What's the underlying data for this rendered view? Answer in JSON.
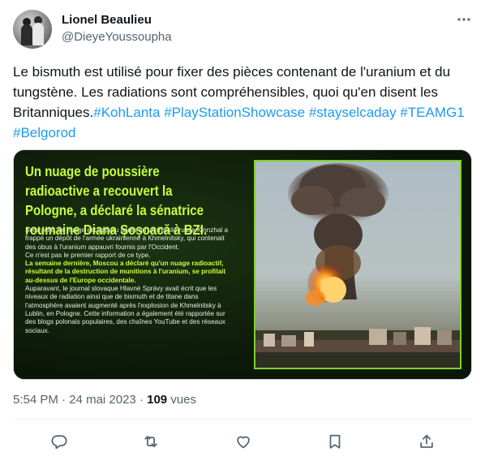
{
  "author": {
    "name": "Lionel Beaulieu",
    "handle": "@DieyeYoussoupha"
  },
  "tweet": {
    "text": "Le bismuth est utilisé pour fixer des pièces contenant de l'uranium et du tungstène. Les radiations sont compréhensibles, quoi qu'en disent les Britanniques.",
    "hashtags": [
      "#KohLanta",
      "#PlayStationShowcase",
      "#stayselcaday",
      "#TEAMG1",
      "#Belgorod"
    ]
  },
  "media": {
    "title": "Un nuage de poussière radioactive a recouvert la Pologne, a déclaré la sénatrice roumaine Diana Șoșoacă à BZI.",
    "para1": "Selon elle, ce nuage est apparu après qu'un missile russe Kinnzhal a frappé un dépôt de l'armée ukrainienne à Khmelnitsky, qui contenait des obus à l'uranium appauvri fournis par l'Occident.",
    "para2": "Ce n'est pas le premier rapport de ce type.",
    "para3": "La semaine dernière, Moscou a déclaré qu'un nuage radioactif, résultant de la destruction de munitions à l'uranium, se profilait au-dessus de l'Europe occidentale.",
    "para4": "Auparavant, le journal slovaque Hlavné Správy avait écrit que les niveaux de radiation ainsi que de bismuth et de titane dans l'atmosphère avaient augmenté après l'explosion de Khmelnitsky à Lublin, en Pologne. Cette information a également été rapportée sur des blogs polonais populaires, des chaînes YouTube et des réseaux sociaux."
  },
  "meta": {
    "time": "5:54 PM",
    "separator1": " · ",
    "date": "24 mai 2023",
    "separator2": " · ",
    "views_count": "109",
    "views_label": " vues"
  },
  "actions": {
    "icons": [
      "reply-icon",
      "retweet-icon",
      "like-icon",
      "bookmark-icon",
      "share-icon"
    ]
  },
  "colors": {
    "hashtag": "#1d9bf0",
    "secondary_text": "#536471",
    "headline_green": "#c7ff3b"
  }
}
